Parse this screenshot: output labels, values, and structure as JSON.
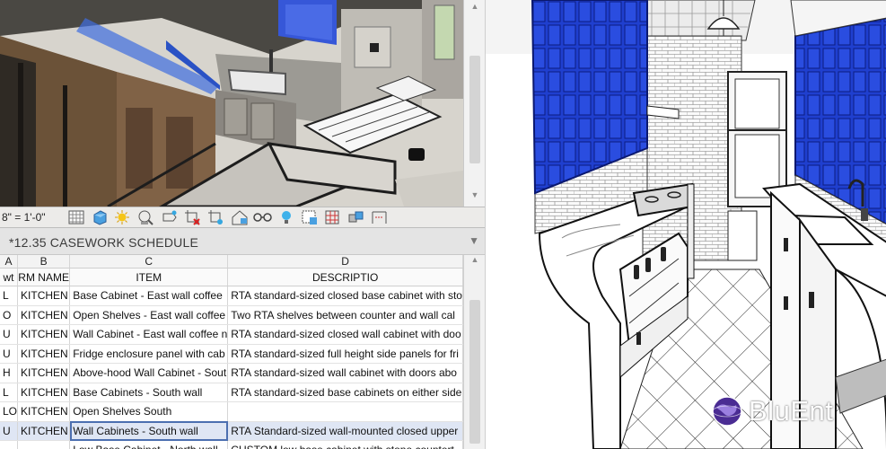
{
  "view": {
    "scale": "8\" = 1'-0\""
  },
  "toolbar_icons": [
    "detail-level-icon",
    "visual-style-icon",
    "sun-path-icon",
    "shadows-icon",
    "render-icon",
    "crop-view-icon",
    "hide-crop-icon",
    "unlock-3d-icon",
    "temporary-hide-icon",
    "reveal-hidden-icon",
    "temporary-view-properties-icon",
    "analytical-model-icon",
    "highlight-displacement-icon",
    "constraints-icon",
    "worksharing-icon"
  ],
  "schedule": {
    "title": "*12.35 CASEWORK SCHEDULE",
    "column_letters": [
      "A",
      "B",
      "C",
      "D"
    ],
    "headers": [
      "wt",
      "RM NAME",
      "ITEM",
      "DESCRIPTIO"
    ],
    "rows": [
      {
        "a": "L",
        "rm": "KITCHEN",
        "item": "Base Cabinet - East wall coffee",
        "desc": "RTA standard-sized closed base cabinet with sto"
      },
      {
        "a": "O",
        "rm": "KITCHEN",
        "item": "Open Shelves - East wall coffee",
        "desc": "Two RTA shelves between counter and wall cal"
      },
      {
        "a": "U",
        "rm": "KITCHEN",
        "item": "Wall Cabinet -  East wall coffee n",
        "desc": "RTA standard-sized closed wall cabinet with doo"
      },
      {
        "a": "U",
        "rm": "KITCHEN",
        "item": "Fridge enclosure panel with cab",
        "desc": "RTA standard-sized full height side panels for fri"
      },
      {
        "a": "H",
        "rm": "KITCHEN",
        "item": "Above-hood Wall Cabinet - Sout",
        "desc": "RTA standard-sized wall cabinet with doors abo"
      },
      {
        "a": "L",
        "rm": "KITCHEN",
        "item": "Base Cabinets - South wall",
        "desc": "RTA standard-sized base cabinets on either side"
      },
      {
        "a": "LO",
        "rm": "KITCHEN",
        "item": "Open Shelves South",
        "desc": ""
      },
      {
        "a": "U",
        "rm": "KITCHEN",
        "item": "Wall Cabinets - South wall",
        "desc": "RTA Standard-sized wall-mounted closed upper"
      },
      {
        "a": "",
        "rm": "",
        "item": "Low Base Cabinet - North wall",
        "desc": "CUSTOM low base cabinet with stone countert"
      }
    ]
  },
  "brand": {
    "name": "BluEnt",
    "globe_color": "#4a2c93"
  },
  "colors": {
    "glass_blue": "#1f3fcf",
    "selection": "#dfe6f4"
  }
}
